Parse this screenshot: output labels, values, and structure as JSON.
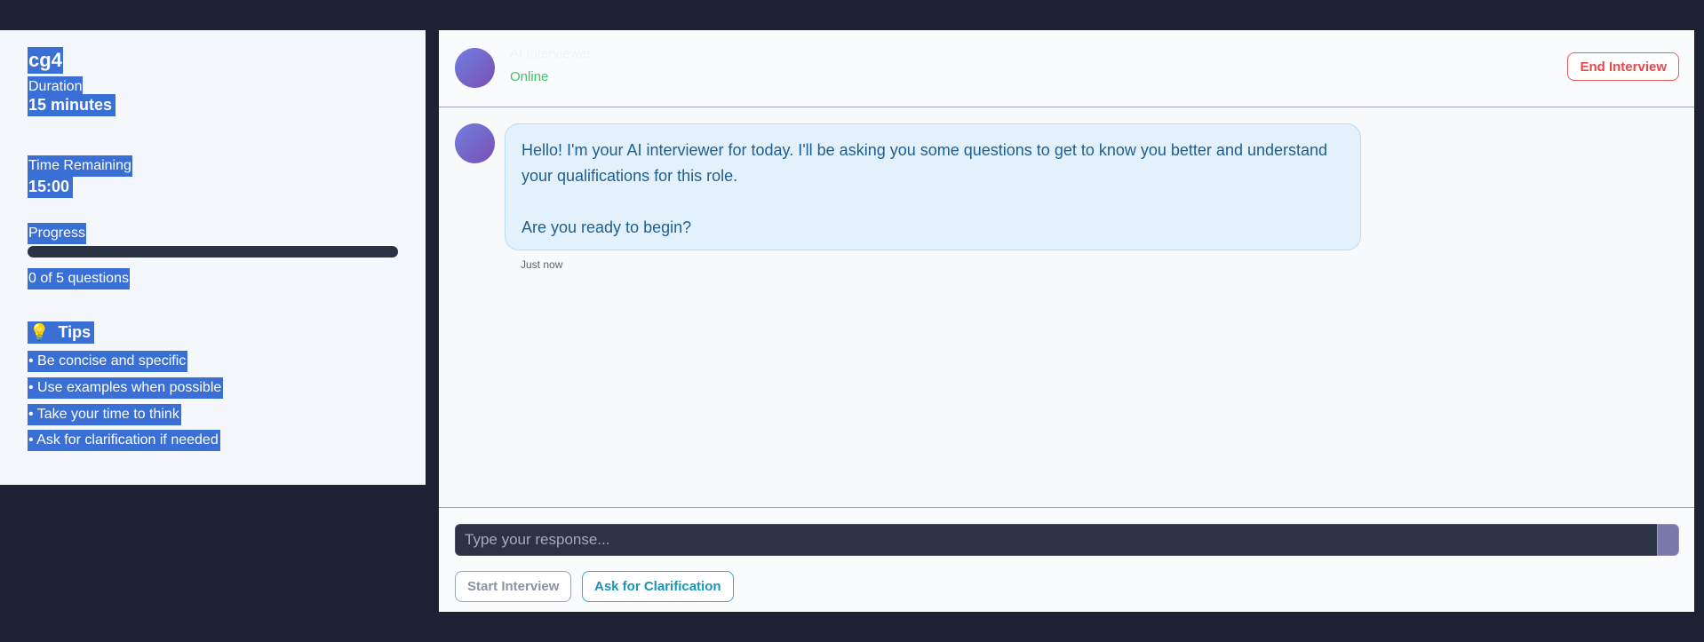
{
  "sidebar": {
    "title": "cg4",
    "duration_label": "Duration",
    "duration_value": "15 minutes",
    "time_label": "Time Remaining",
    "time_value": "15:00",
    "progress_label": "Progress",
    "progress_fraction": 0,
    "progress_text": "0 of 5 questions",
    "tips_icon": "lightbulb-icon",
    "tips_glyph": "💡",
    "tips_heading": "Tips",
    "tips": [
      "• Be concise and specific",
      "• Use examples when possible",
      "• Take your time to think",
      "• Ask for clarification if needed"
    ]
  },
  "chat": {
    "header": {
      "name": "AI Interviewer",
      "status": "Online",
      "end_label": "End Interview"
    },
    "message": {
      "paragraph1": "Hello! I'm your AI interviewer for today. I'll be asking you some questions to get to know you better and understand your qualifications for this role.",
      "paragraph2": "Are you ready to begin?",
      "time": "Just now"
    },
    "composer": {
      "placeholder": "Type your response...",
      "start_label": "Start Interview",
      "clarify_label": "Ask for Clarification"
    }
  },
  "colors": {
    "background": "#1c2233",
    "selection": "#3a6fd6",
    "status_online": "#3cc46a",
    "danger": "#e5484d",
    "accent_teal": "#1a95b3",
    "bubble_bg": "#e3f1fd"
  }
}
